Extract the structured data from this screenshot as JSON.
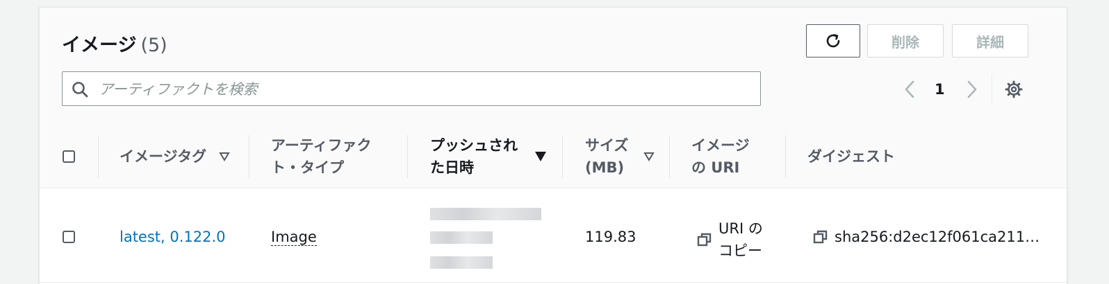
{
  "header": {
    "title": "イメージ",
    "count": "(5)",
    "buttons": {
      "delete": "削除",
      "details": "詳細"
    }
  },
  "search": {
    "placeholder": "アーティファクトを検索",
    "value": ""
  },
  "pagination": {
    "current_page": "1"
  },
  "table": {
    "columns": [
      {
        "label": "イメージタグ",
        "sort": "sortable"
      },
      {
        "label": "アーティファク\nト・タイプ",
        "sort": "none"
      },
      {
        "label": "プッシュされ\nた日時",
        "sort": "descending"
      },
      {
        "label": "サイズ\n(MB)",
        "sort": "sortable"
      },
      {
        "label": "イメージ\nの URI",
        "sort": "none"
      },
      {
        "label": "ダイジェスト",
        "sort": "none"
      }
    ],
    "rows": [
      {
        "tag": "latest, 0.122.0",
        "type": "Image",
        "size": "119.83",
        "uri_copy": "URI の\nコピー",
        "digest": "sha256:d2ec12f061ca211…"
      }
    ]
  },
  "icons": {
    "refresh": "refresh-icon",
    "search": "search-icon",
    "prev": "chevron-left-icon",
    "next": "chevron-right-icon",
    "settings": "gear-icon",
    "copy": "copy-icon",
    "sort_desc": "caret-down-filled-icon",
    "sortable": "caret-down-outline-icon"
  },
  "colors": {
    "link": "#0073bb",
    "text": "#16191f",
    "muted": "#545b64",
    "disabled": "#aab7b8"
  }
}
